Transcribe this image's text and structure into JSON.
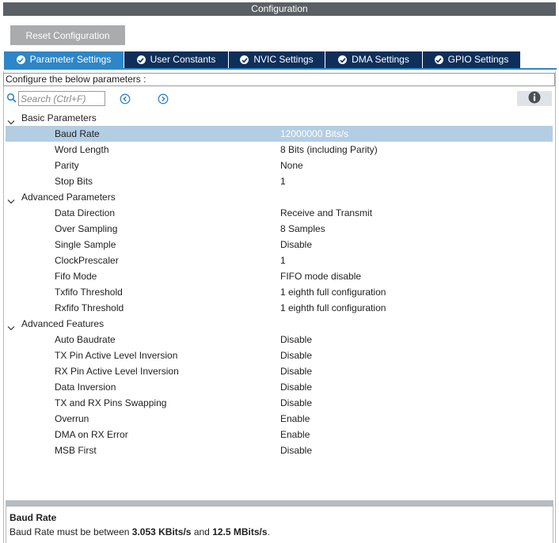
{
  "window": {
    "title": "Configuration"
  },
  "toolbar": {
    "reset_label": "Reset Configuration"
  },
  "tabs": [
    {
      "label": "Parameter Settings",
      "active": true
    },
    {
      "label": "User Constants",
      "active": false
    },
    {
      "label": "NVIC Settings",
      "active": false
    },
    {
      "label": "DMA Settings",
      "active": false
    },
    {
      "label": "GPIO Settings",
      "active": false
    }
  ],
  "configure_text": "Configure the below parameters :",
  "search": {
    "placeholder": "Search (Ctrl+F)",
    "value": ""
  },
  "icons": {
    "search": "search-icon",
    "prev": "arrow-left-circle-icon",
    "next": "arrow-right-circle-icon",
    "info": "info-icon",
    "expand": "chevron-down-icon",
    "tab_check": "check-circle-icon"
  },
  "colors": {
    "title_bar": "#5b6066",
    "tab_active": "#2d86c7",
    "tab_inactive": "#0e2f5a",
    "selected_row": "#b3cde3",
    "nav_icon": "#2d86c7"
  },
  "groups": [
    {
      "label": "Basic Parameters",
      "params": [
        {
          "name": "Baud Rate",
          "value": "12000000 Bits/s",
          "selected": true
        },
        {
          "name": "Word Length",
          "value": "8 Bits (including Parity)"
        },
        {
          "name": "Parity",
          "value": "None"
        },
        {
          "name": "Stop Bits",
          "value": "1"
        }
      ]
    },
    {
      "label": "Advanced Parameters",
      "params": [
        {
          "name": "Data Direction",
          "value": "Receive and Transmit"
        },
        {
          "name": "Over Sampling",
          "value": "8 Samples"
        },
        {
          "name": "Single Sample",
          "value": "Disable"
        },
        {
          "name": "ClockPrescaler",
          "value": "1"
        },
        {
          "name": "Fifo Mode",
          "value": "FIFO mode disable"
        },
        {
          "name": "Txfifo Threshold",
          "value": "1 eighth full configuration"
        },
        {
          "name": "Rxfifo Threshold",
          "value": "1 eighth full configuration"
        }
      ]
    },
    {
      "label": "Advanced Features",
      "params": [
        {
          "name": "Auto Baudrate",
          "value": "Disable"
        },
        {
          "name": "TX Pin Active Level Inversion",
          "value": "Disable"
        },
        {
          "name": "RX Pin Active Level Inversion",
          "value": "Disable"
        },
        {
          "name": "Data Inversion",
          "value": "Disable"
        },
        {
          "name": "TX and RX Pins Swapping",
          "value": "Disable"
        },
        {
          "name": "Overrun",
          "value": "Enable"
        },
        {
          "name": "DMA on RX Error",
          "value": "Enable"
        },
        {
          "name": "MSB First",
          "value": "Disable"
        }
      ]
    }
  ],
  "description": {
    "title": "Baud Rate",
    "text_prefix": "Baud Rate must be between ",
    "min": "3.053 KBits/s",
    "text_mid": " and ",
    "max": "12.5 MBits/s",
    "text_suffix": "."
  }
}
